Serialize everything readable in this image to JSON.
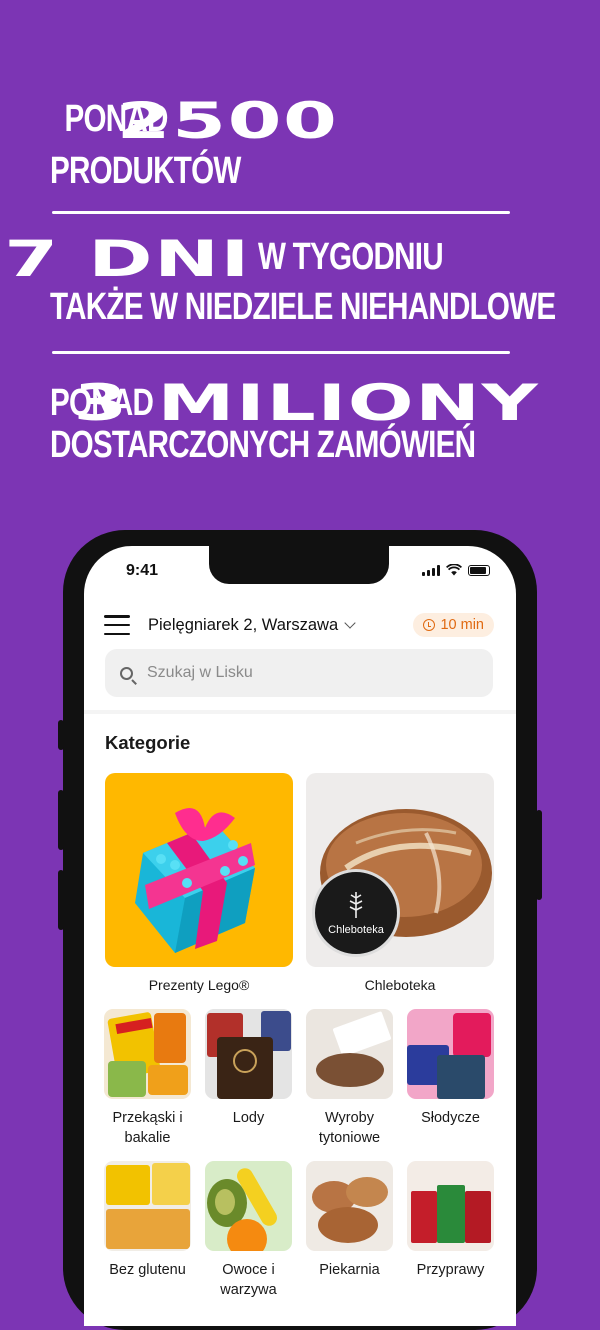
{
  "promo": {
    "line1_pre": "Ponad",
    "line1_big": "2500",
    "line2": "produktów",
    "line3_big": "7 dni",
    "line3_post": "w tygodniu",
    "line4": "także w niedziele niehandlowe",
    "line5_pre": "Ponad",
    "line5_big": "3 miliony",
    "line6": "dostarczonych zamówień"
  },
  "status_bar": {
    "time": "9:41"
  },
  "header": {
    "address": "Pielęgniarek 2, Warszawa",
    "eta": "10 min"
  },
  "search": {
    "placeholder": "Szukaj w Lisku"
  },
  "section_title": "Kategorie",
  "featured": [
    {
      "label": "Prezenty Lego®"
    },
    {
      "label": "Chleboteka",
      "badge": "Chleboteka"
    }
  ],
  "categories_row1": [
    {
      "label": "Przekąski i bakalie"
    },
    {
      "label": "Lody"
    },
    {
      "label": "Wyroby tytoniowe"
    },
    {
      "label": "Słodycze"
    }
  ],
  "categories_row2": [
    {
      "label": "Bez glutenu"
    },
    {
      "label": "Owoce i warzywa"
    },
    {
      "label": "Piekarnia"
    },
    {
      "label": "Przyprawy"
    }
  ],
  "colors": {
    "background": "#7c35b4",
    "eta_bg": "#fdeee0",
    "eta_text": "#e06a12",
    "lego_bg": "#ffb800"
  }
}
